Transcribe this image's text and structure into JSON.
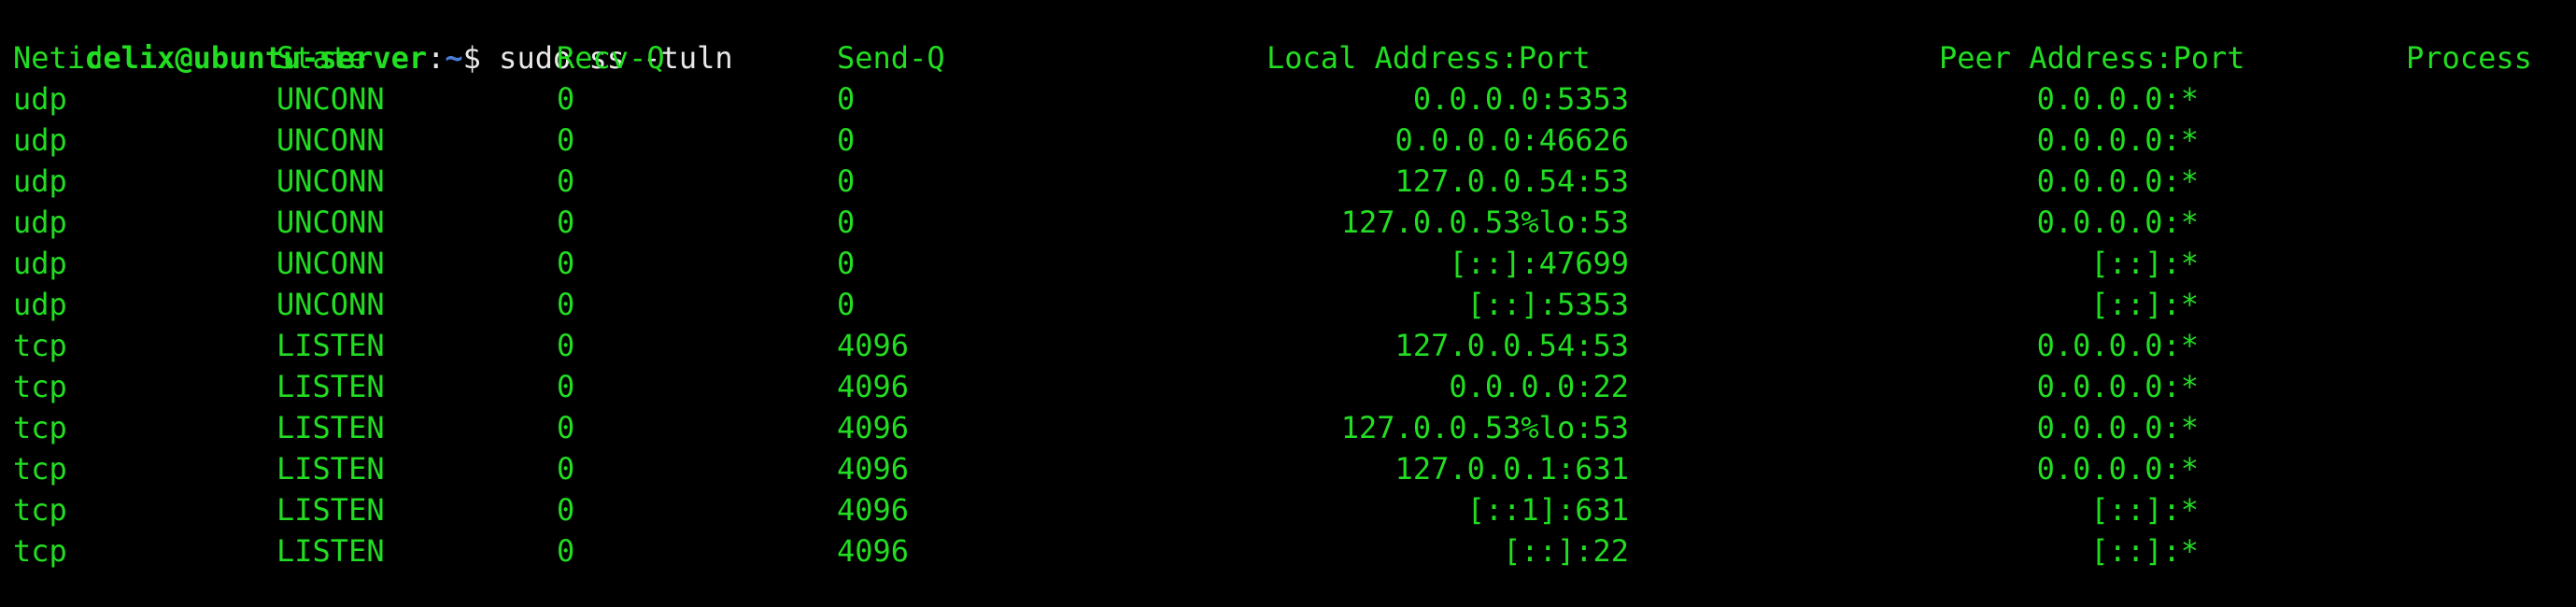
{
  "prompt": {
    "user_host": "celix@ubuntu-server",
    "separator": ":",
    "path": "~",
    "symbol": "$",
    "command": "sudo ss -tuln"
  },
  "table": {
    "headers": {
      "netid": "Netid",
      "state": "State",
      "recvq": "Recv-Q",
      "sendq": "Send-Q",
      "local": "Local Address:Port",
      "peer": "Peer Address:Port",
      "process": "Process"
    },
    "rows": [
      {
        "netid": "udp",
        "state": "UNCONN",
        "recvq": "0",
        "sendq": "0",
        "local": "0.0.0.0:5353",
        "peer": "0.0.0.0:*"
      },
      {
        "netid": "udp",
        "state": "UNCONN",
        "recvq": "0",
        "sendq": "0",
        "local": "0.0.0.0:46626",
        "peer": "0.0.0.0:*"
      },
      {
        "netid": "udp",
        "state": "UNCONN",
        "recvq": "0",
        "sendq": "0",
        "local": "127.0.0.54:53",
        "peer": "0.0.0.0:*"
      },
      {
        "netid": "udp",
        "state": "UNCONN",
        "recvq": "0",
        "sendq": "0",
        "local": "127.0.0.53%lo:53",
        "peer": "0.0.0.0:*"
      },
      {
        "netid": "udp",
        "state": "UNCONN",
        "recvq": "0",
        "sendq": "0",
        "local": "[::]:47699",
        "peer": "[::]:*"
      },
      {
        "netid": "udp",
        "state": "UNCONN",
        "recvq": "0",
        "sendq": "0",
        "local": "[::]:5353",
        "peer": "[::]:*"
      },
      {
        "netid": "tcp",
        "state": "LISTEN",
        "recvq": "0",
        "sendq": "4096",
        "local": "127.0.0.54:53",
        "peer": "0.0.0.0:*"
      },
      {
        "netid": "tcp",
        "state": "LISTEN",
        "recvq": "0",
        "sendq": "4096",
        "local": "0.0.0.0:22",
        "peer": "0.0.0.0:*"
      },
      {
        "netid": "tcp",
        "state": "LISTEN",
        "recvq": "0",
        "sendq": "4096",
        "local": "127.0.0.53%lo:53",
        "peer": "0.0.0.0:*"
      },
      {
        "netid": "tcp",
        "state": "LISTEN",
        "recvq": "0",
        "sendq": "4096",
        "local": "127.0.0.1:631",
        "peer": "0.0.0.0:*"
      },
      {
        "netid": "tcp",
        "state": "LISTEN",
        "recvq": "0",
        "sendq": "4096",
        "local": "[::1]:631",
        "peer": "[::]:*"
      },
      {
        "netid": "tcp",
        "state": "LISTEN",
        "recvq": "0",
        "sendq": "4096",
        "local": "[::]:22",
        "peer": "[::]:*"
      }
    ]
  },
  "colors": {
    "background": "#000000",
    "text_green": "#22dd22",
    "prompt_path_blue": "#4a7fd8",
    "command_white": "#e8e8e8"
  }
}
